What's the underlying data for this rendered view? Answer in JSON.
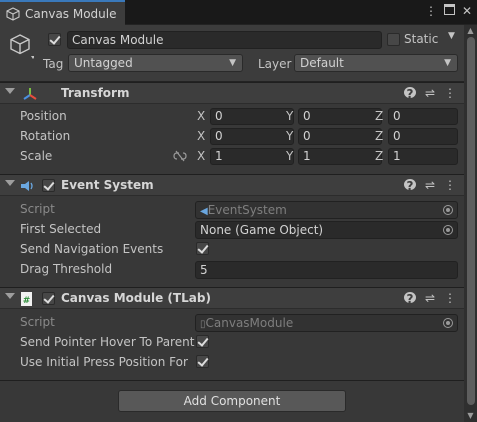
{
  "tab": {
    "title": "Canvas Module",
    "tools": [
      "more-vert",
      "maximize",
      "close"
    ]
  },
  "gameobject": {
    "active": true,
    "name": "Canvas Module",
    "static_label": "Static",
    "static": false,
    "tag_label": "Tag",
    "tag_value": "Untagged",
    "layer_label": "Layer",
    "layer_value": "Default"
  },
  "transform": {
    "title": "Transform",
    "rows": [
      {
        "label": "Position",
        "x": "0",
        "y": "0",
        "z": "0"
      },
      {
        "label": "Rotation",
        "x": "0",
        "y": "0",
        "z": "0"
      },
      {
        "label": "Scale",
        "x": "1",
        "y": "1",
        "z": "1"
      }
    ],
    "axis_labels": [
      "X",
      "Y",
      "Z"
    ]
  },
  "event_system": {
    "title": "Event System",
    "enabled": true,
    "script_label": "Script",
    "script_value": "EventSystem",
    "first_selected_label": "First Selected",
    "first_selected_value": "None (Game Object)",
    "send_nav_label": "Send Navigation Events",
    "send_nav": true,
    "drag_threshold_label": "Drag Threshold",
    "drag_threshold_value": "5"
  },
  "canvas_module": {
    "title": "Canvas Module (TLab)",
    "enabled": true,
    "script_label": "Script",
    "script_value": "CanvasModule",
    "hover_label": "Send Pointer Hover To Parent",
    "hover": true,
    "initial_label": "Use Initial Press Position For Dr",
    "initial": true
  },
  "add_component_label": "Add Component",
  "colors": {
    "accent": "#3a79bb",
    "background": "#383838",
    "header": "#3e3e3e",
    "field": "#2a2a2a"
  }
}
